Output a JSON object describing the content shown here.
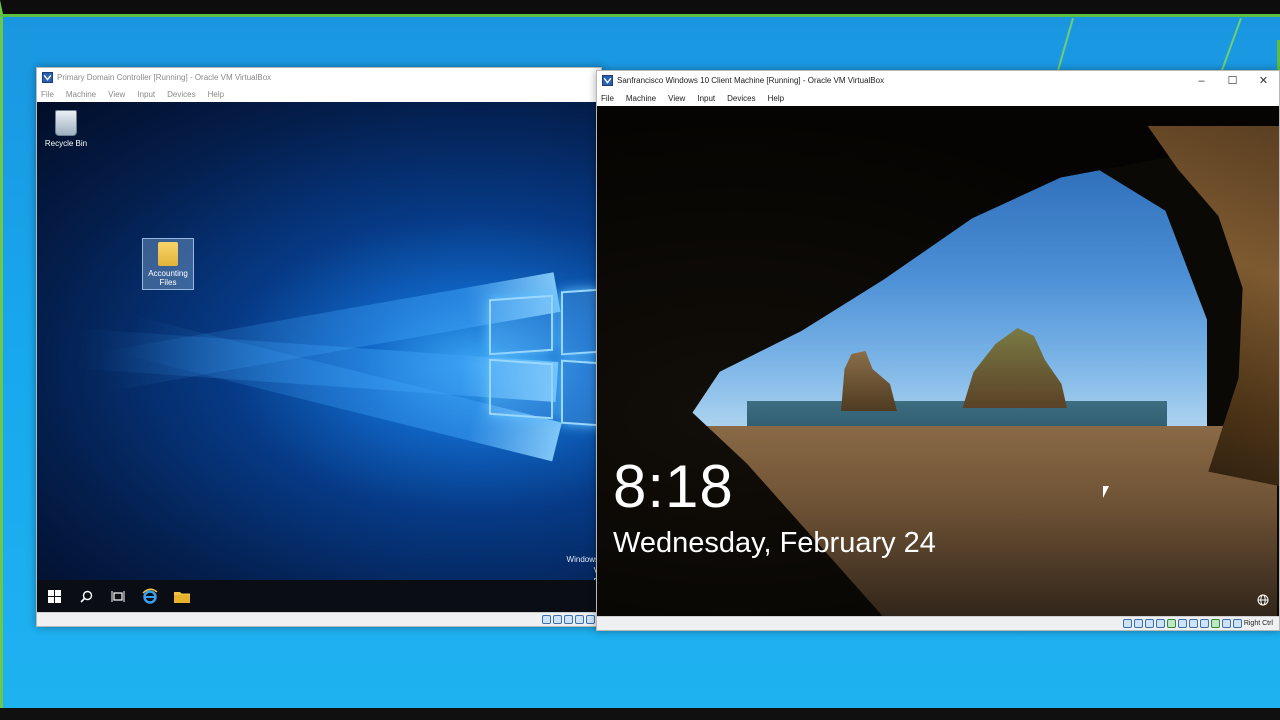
{
  "vm1": {
    "title": "Primary Domain Controller [Running] - Oracle VM VirtualBox",
    "menu": [
      "File",
      "Machine",
      "View",
      "Input",
      "Devices",
      "Help"
    ],
    "desktop_icons": [
      {
        "label": "Recycle Bin",
        "icon": "recycle-bin-icon"
      },
      {
        "label": "Accounting Files",
        "icon": "folder-icon"
      }
    ],
    "watermark_line1": "Windows",
    "watermark_line2": "V",
    "watermark_line3": "B",
    "taskbar_icons": [
      "start-icon",
      "search-icon",
      "task-view-icon",
      "internet-explorer-icon",
      "file-explorer-icon"
    ]
  },
  "vm2": {
    "title": "Sanfrancisco Windows 10 Client Machine [Running] - Oracle VM VirtualBox",
    "menu": [
      "File",
      "Machine",
      "View",
      "Input",
      "Devices",
      "Help"
    ],
    "window_controls": {
      "minimize": "–",
      "maximize": "☐",
      "close": "✕"
    },
    "lock_screen": {
      "time": "8:18",
      "date": "Wednesday, February 24"
    },
    "host_key_label": "Right Ctrl"
  }
}
